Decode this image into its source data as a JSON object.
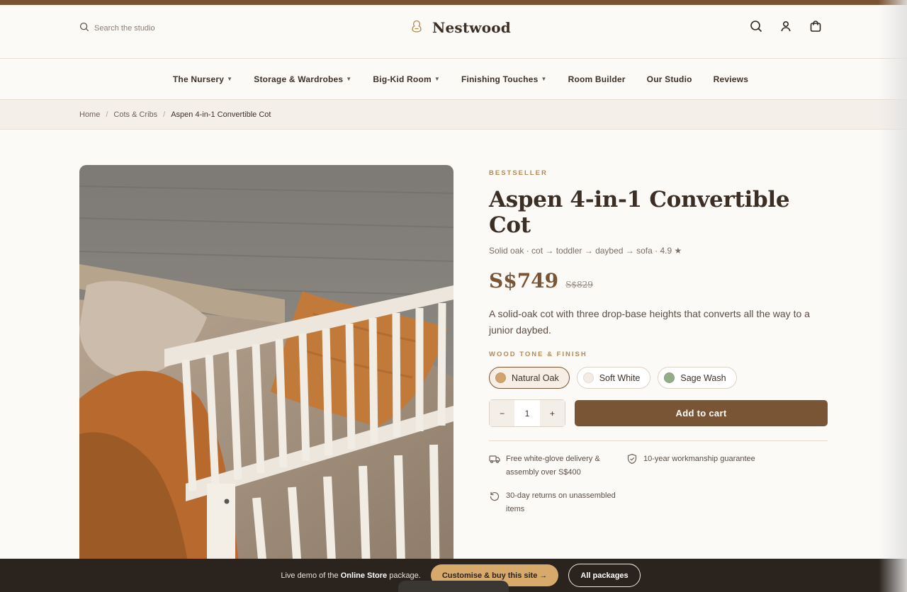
{
  "header": {
    "search_placeholder": "Search the studio",
    "brand": "Nestwood",
    "icons": [
      "search-icon",
      "account-icon",
      "cart-icon"
    ]
  },
  "nav": {
    "items": [
      {
        "label": "The Nursery",
        "dropdown": true
      },
      {
        "label": "Storage & Wardrobes",
        "dropdown": true
      },
      {
        "label": "Big-Kid Room",
        "dropdown": true
      },
      {
        "label": "Finishing Touches",
        "dropdown": true
      },
      {
        "label": "Room Builder",
        "dropdown": false
      },
      {
        "label": "Our Studio",
        "dropdown": false
      },
      {
        "label": "Reviews",
        "dropdown": false
      }
    ]
  },
  "breadcrumb": {
    "home": "Home",
    "category": "Cots & Cribs",
    "current": "Aspen 4-in-1 Convertible Cot"
  },
  "product": {
    "badge": "BESTSELLER",
    "title": "Aspen 4-in-1 Convertible Cot",
    "specs": "Solid oak · cot → toddler → daybed → sofa · 4.9 ★",
    "price": "S$749",
    "old_price": "S$829",
    "description": "A solid-oak cot with three drop-base heights that converts all the way to a junior daybed.",
    "finish_label": "WOOD TONE & FINISH",
    "finishes": [
      {
        "label": "Natural Oak",
        "color": "#d1a46f",
        "selected": true
      },
      {
        "label": "Soft White",
        "color": "#f3ebe4",
        "selected": false
      },
      {
        "label": "Sage Wash",
        "color": "#92ad87",
        "selected": false
      }
    ],
    "quantity": "1",
    "qty_minus": "−",
    "qty_plus": "+",
    "add_to_cart": "Add to cart",
    "perks": [
      {
        "icon": "truck-icon",
        "text": "Free white-glove delivery & assembly over S$400"
      },
      {
        "icon": "shield-check-icon",
        "text": "10-year workmanship guarantee"
      },
      {
        "icon": "return-icon",
        "text": "30-day returns on unassembled items"
      }
    ]
  },
  "demo_bar": {
    "text_prefix": "Live demo of the",
    "text_strong": "Online Store",
    "text_suffix": "package.",
    "cta": "Customise & buy this site →",
    "packages": "All packages"
  },
  "colors": {
    "accent": "#7a5535",
    "gold": "#b28a52",
    "background": "#fcfaf7",
    "footer": "#2b231d"
  }
}
